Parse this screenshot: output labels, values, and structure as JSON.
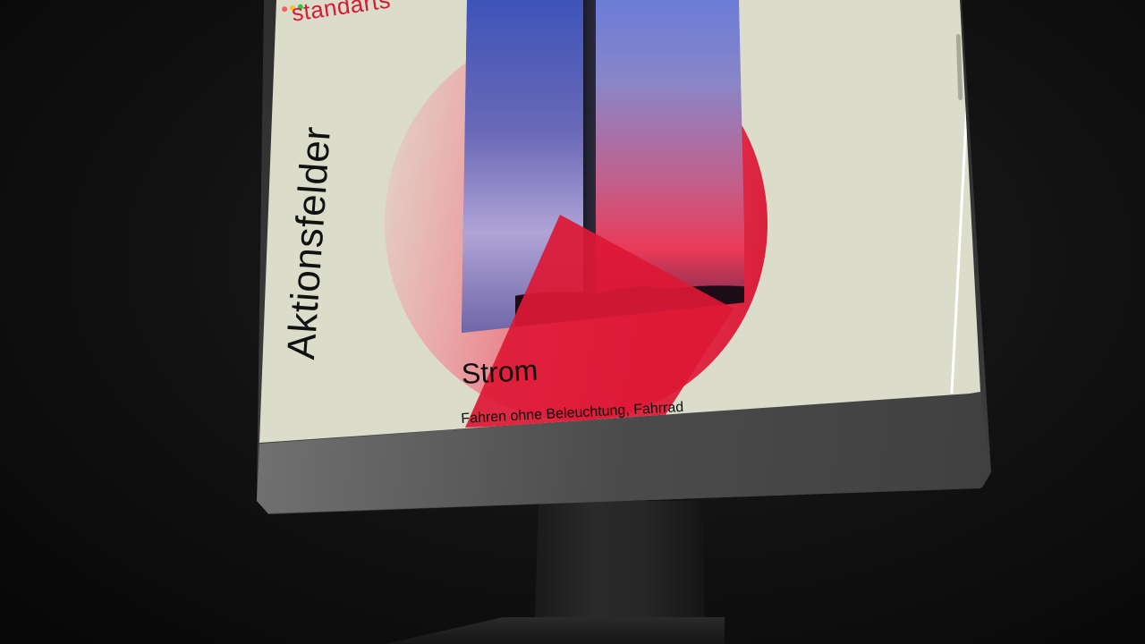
{
  "site": {
    "brand": "standarts",
    "page_heading": "Aktionsfelder"
  },
  "window": {
    "controls": [
      {
        "name": "close",
        "color": "#ff5f57"
      },
      {
        "name": "minimize",
        "color": "#febc2e"
      },
      {
        "name": "maximize",
        "color": "#28c840"
      }
    ]
  },
  "feature": {
    "title": "Strom",
    "description": "Fahren ohne Beleuchtung, Fahrrad"
  },
  "colors": {
    "accent": "#d61a35",
    "page_background": "#dcdccb",
    "text": "#111111"
  }
}
